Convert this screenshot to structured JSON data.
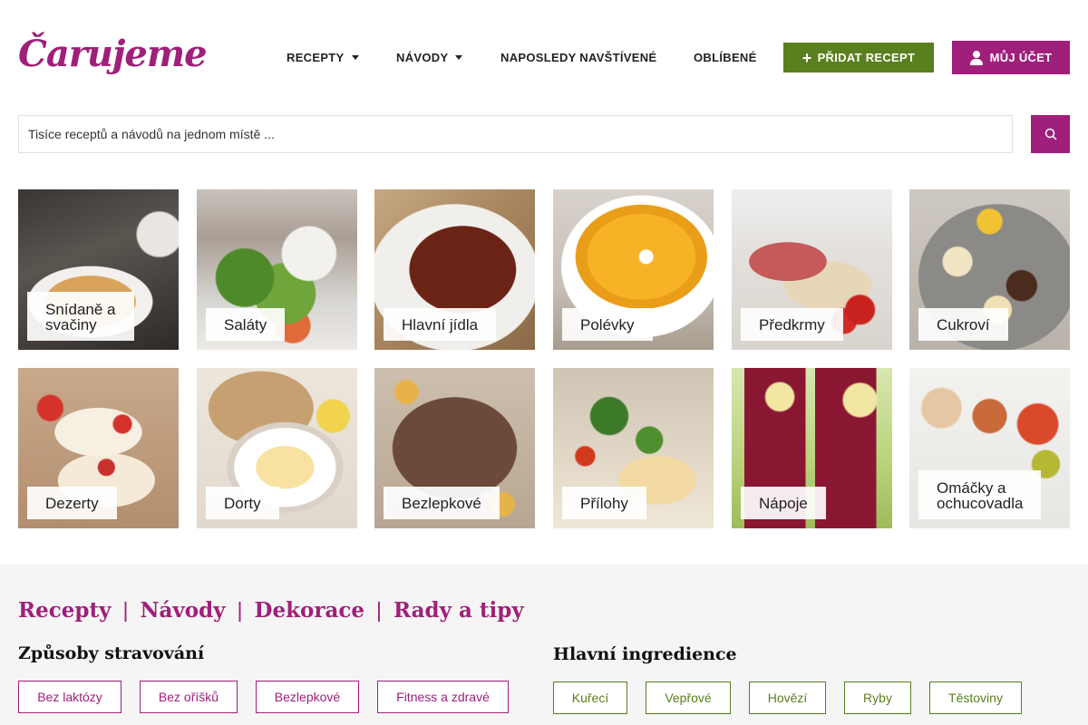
{
  "header": {
    "logo": "Čarujeme",
    "nav": [
      {
        "label": "RECEPTY"
      },
      {
        "label": "NÁVODY"
      },
      {
        "label": "NAPOSLEDY NAVŠTÍVENÉ"
      },
      {
        "label": "OBLÍBENÉ"
      }
    ],
    "add_recipe": "PŘIDAT RECEPT",
    "account": "MŮJ ÚČET"
  },
  "search": {
    "placeholder": "Tisíce receptů a návodů na jednom místě ..."
  },
  "categories": [
    {
      "label_1": "Snídaně a",
      "label_2": "svačiny"
    },
    {
      "label": "Saláty"
    },
    {
      "label": "Hlavní jídla"
    },
    {
      "label": "Polévky"
    },
    {
      "label": "Předkrmy"
    },
    {
      "label": "Cukroví"
    },
    {
      "label": "Dezerty"
    },
    {
      "label": "Dorty"
    },
    {
      "label": "Bezlepkové"
    },
    {
      "label": "Přílohy"
    },
    {
      "label": "Nápoje"
    },
    {
      "label_1": "Omáčky a",
      "label_2": "ochucovadla"
    }
  ],
  "sections": {
    "links": [
      "Recepty",
      "Návody",
      "Dekorace",
      "Rady a tipy"
    ],
    "diets_title": "Způsoby stravování",
    "diets": [
      "Bez laktózy",
      "Bez oříšků",
      "Bezlepkové",
      "Fitness a zdravé"
    ],
    "ingredients_title": "Hlavní ingredience",
    "ingredients": [
      "Kuřecí",
      "Vepřové",
      "Hovězí",
      "Ryby",
      "Těstoviny"
    ]
  },
  "colors": {
    "brand": "#a01f7a",
    "green": "#5a7f1e"
  }
}
